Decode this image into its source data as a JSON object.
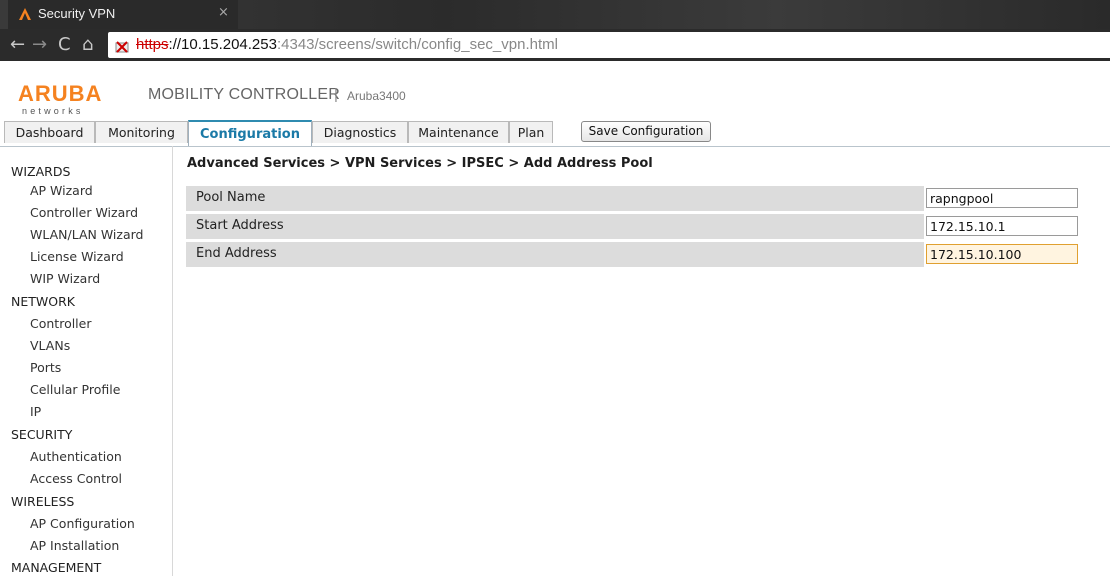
{
  "browser": {
    "tab_title": "Security VPN",
    "tab_close": "×",
    "url_scheme": "https",
    "url_host": "://10.15.204.253",
    "url_rest": ":4343/screens/switch/config_sec_vpn.html",
    "nav": {
      "back": "←",
      "forward": "→",
      "reload": "C",
      "home": "⌂"
    }
  },
  "header": {
    "logo_text": "ARUBA",
    "logo_sub": "networks",
    "title": "MOBILITY CONTROLLER",
    "separator": "|",
    "device": "Aruba3400"
  },
  "tabs": [
    {
      "label": "Dashboard",
      "active": false
    },
    {
      "label": "Monitoring",
      "active": false
    },
    {
      "label": "Configuration",
      "active": true
    },
    {
      "label": "Diagnostics",
      "active": false
    },
    {
      "label": "Maintenance",
      "active": false
    },
    {
      "label": "Plan",
      "active": false
    }
  ],
  "save_button": "Save Configuration",
  "sidebar": {
    "groups": [
      {
        "title": "WIZARDS",
        "items": [
          "AP Wizard",
          "Controller Wizard",
          "WLAN/LAN Wizard",
          "License Wizard",
          "WIP Wizard"
        ]
      },
      {
        "title": "NETWORK",
        "items": [
          "Controller",
          "VLANs",
          "Ports",
          "Cellular Profile",
          "IP"
        ]
      },
      {
        "title": "SECURITY",
        "items": [
          "Authentication",
          "Access Control"
        ]
      },
      {
        "title": "WIRELESS",
        "items": [
          "AP Configuration",
          "AP Installation"
        ]
      },
      {
        "title": "MANAGEMENT",
        "items": []
      }
    ]
  },
  "content": {
    "breadcrumb": "Advanced Services > VPN Services > IPSEC > Add Address Pool",
    "fields": [
      {
        "label": "Pool Name",
        "value": "rapngpool",
        "focused": false
      },
      {
        "label": "Start Address",
        "value": "172.15.10.1",
        "focused": false
      },
      {
        "label": "End Address",
        "value": "172.15.10.100",
        "focused": true
      }
    ]
  },
  "colors": {
    "accent": "#1b7aa7",
    "logo_orange": "#f58220",
    "focus_border": "#e0a030",
    "focus_bg": "#fff4e0",
    "row_bg": "#dcdcdc"
  }
}
